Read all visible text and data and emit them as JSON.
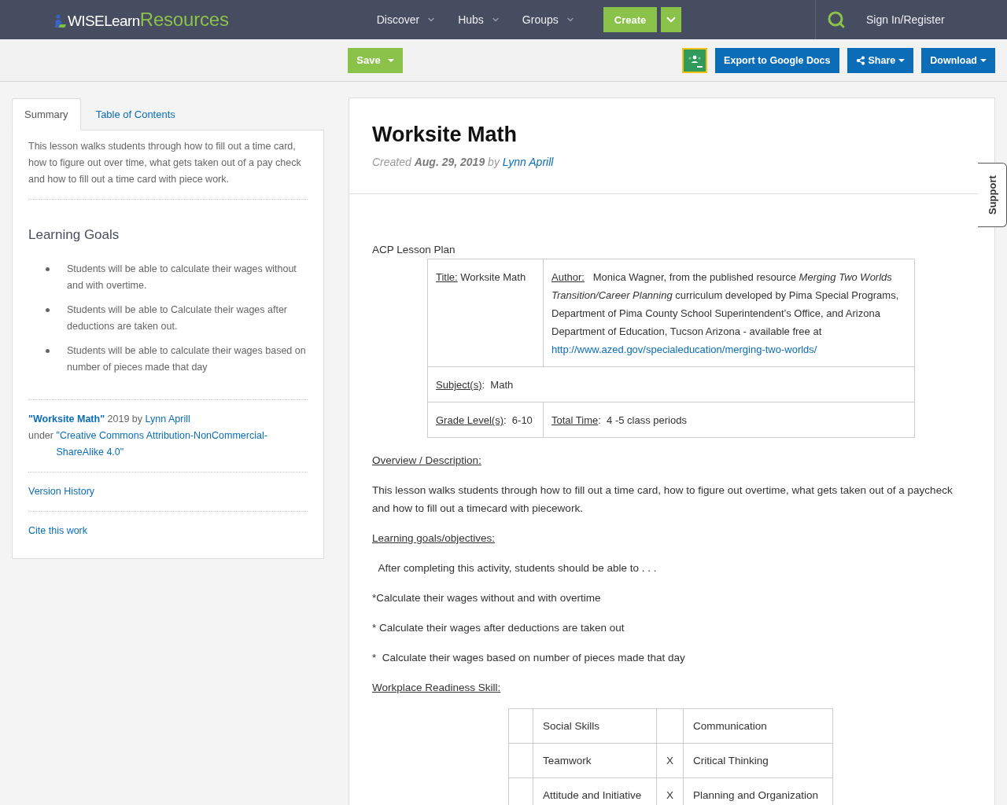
{
  "top_nav": {
    "logo": {
      "brand": "WISELearn",
      "product": "Resources"
    },
    "menu": [
      {
        "label": "Discover"
      },
      {
        "label": "Hubs"
      },
      {
        "label": "Groups"
      }
    ],
    "create_button": "Create",
    "sign_in": "Sign In/Register"
  },
  "toolbar": {
    "save_button": "Save",
    "export_button": "Export to Google Docs",
    "share_button": "Share",
    "download_button": "Download"
  },
  "sidebar": {
    "tabs": [
      {
        "label": "Summary",
        "selected": true
      },
      {
        "label": "Table of Contents",
        "selected": false
      }
    ],
    "summary": "This lesson walks students through how to fill out a time card, how to figure out over time, what gets taken out of a pay check and how to fill out a time card with piece work.",
    "goals_heading": "Learning Goals",
    "goals": [
      "Students will be able to calculate their wages without and with overtime.",
      "Students will be able to Calculate their wages after deductions are taken out.",
      "Students will be able to calculate their wages based on number of pieces made that day"
    ],
    "attribution": {
      "title_link": "\"Worksite Math\"",
      "year_by": "2019 by",
      "author_link": "Lynn Aprill",
      "under": "under",
      "license_link": "\"Creative Commons Attribution-NonCommercial-ShareAlike 4.0\""
    },
    "links": [
      "Version History",
      "Cite this work"
    ]
  },
  "lesson": {
    "title": "Worksite Math",
    "created": "Created **Aug. 29, 2019** by",
    "author_link": "Lynn Aprill",
    "content": [
      {
        "kind": "label",
        "text": "ACP Lesson Plan"
      },
      {
        "kind": "info_table",
        "rows": [
          [
            {
              "label": "Title:",
              "text": " Worksite Math"
            },
            {
              "label": "Author:",
              "text": "   Monica Wagner, from the published resource *Merging Two Worlds Transition/Career Planning* curriculum developed by Pima Special Programs, Department of Pima County School Superintendent’s Office, and Arizona Department of Education, Tucson Arizona - available free at",
              "link": "http://www.azed.gov/specialeducation/merging-two-worlds/"
            }
          ],
          [
            {
              "label": "Subject(s)",
              "text": ":  Math",
              "colspan": 2
            }
          ],
          [
            {
              "label": "Grade Level(s)",
              "text": ":  6-10"
            },
            {
              "label": "Total Time",
              "text": ":  4 -5 class periods"
            }
          ]
        ]
      },
      {
        "kind": "heading",
        "text": "Overview / Description:"
      },
      {
        "kind": "paragraph",
        "text": "This lesson walks students through how to fill out a time card, how to figure out overtime, what gets taken out of a paycheck and how to fill out a timecard with piecework."
      },
      {
        "kind": "heading",
        "text": "Learning goals/objectives:"
      },
      {
        "kind": "paragraph",
        "text": "  After completing this activity, students should be able to . . ."
      },
      {
        "kind": "paragraph",
        "text": "*Calculate their wages without and with overtime"
      },
      {
        "kind": "paragraph",
        "text": "* Calculate their wages after deductions are taken out"
      },
      {
        "kind": "paragraph",
        "text": "*  Calculate their wages based on number of pieces made that day"
      },
      {
        "kind": "heading",
        "text": "Workplace Readiness Skill:"
      },
      {
        "kind": "skills_table",
        "rows": [
          {
            "skill_1": "Social Skills",
            "skill_2": "Communication"
          },
          {
            "skill_1": "Teamwork",
            "mark_2": "X",
            "skill_2": "Critical Thinking"
          },
          {
            "skill_1": "Attitude and Initiative",
            "mark_2": "X",
            "skill_2": "Planning and Organization"
          }
        ]
      }
    ]
  },
  "support_tab": "Support"
}
